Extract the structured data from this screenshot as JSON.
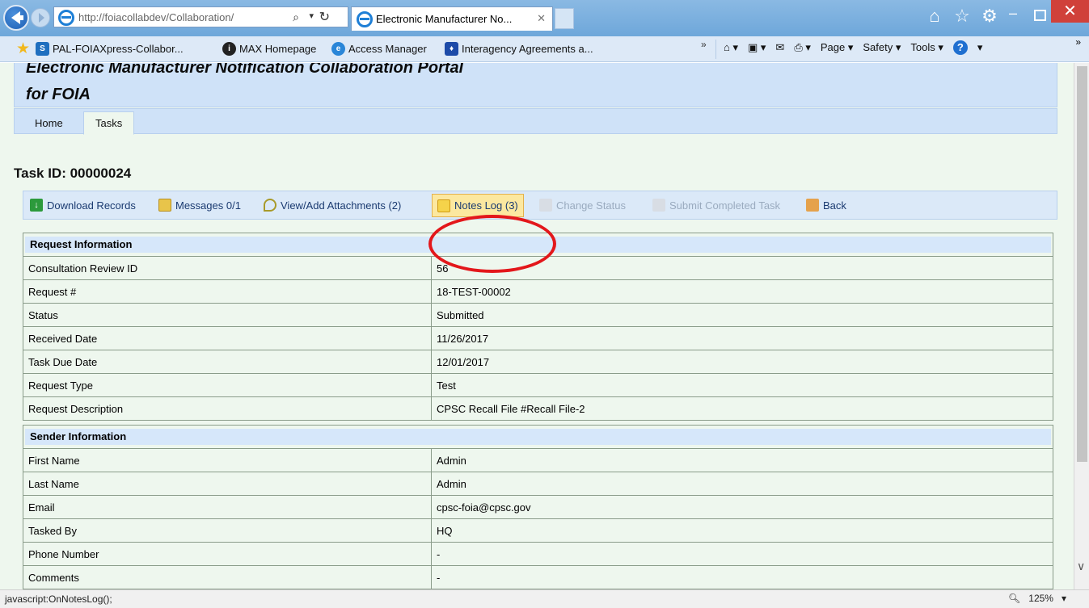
{
  "browser": {
    "address_url": "http://foiacollabdev/Collaboration/",
    "tab_title": "Electronic Manufacturer No...",
    "favorites": [
      "PAL-FOIAXpress-Collabor...",
      "MAX Homepage",
      "Access Manager",
      "Interagency Agreements a..."
    ],
    "commands": {
      "page": "Page",
      "safety": "Safety",
      "tools": "Tools"
    },
    "status_text": "javascript:OnNotesLog();",
    "zoom": "125%"
  },
  "site": {
    "title_line1": "Electronic Manufacturer Notification Collaboration Portal",
    "title_line2": "for FOIA",
    "nav": [
      "Home",
      "Tasks"
    ]
  },
  "task": {
    "heading": "Task ID: 00000024",
    "toolbar": {
      "download": "Download Records",
      "messages": "Messages 0/1",
      "attachments": "View/Add Attachments (2)",
      "notes": "Notes Log (3)",
      "change_status": "Change Status",
      "submit": "Submit Completed Task",
      "back": "Back"
    }
  },
  "request_info": {
    "heading": "Request Information",
    "rows": [
      {
        "label": "Consultation Review ID",
        "value": "56"
      },
      {
        "label": "Request #",
        "value": "18-TEST-00002"
      },
      {
        "label": "Status",
        "value": "Submitted"
      },
      {
        "label": "Received Date",
        "value": "11/26/2017"
      },
      {
        "label": "Task Due Date",
        "value": "12/01/2017"
      },
      {
        "label": "Request Type",
        "value": "Test"
      },
      {
        "label": "Request Description",
        "value": "CPSC Recall File #Recall File-2"
      }
    ]
  },
  "sender_info": {
    "heading": "Sender Information",
    "rows": [
      {
        "label": "First Name",
        "value": "Admin"
      },
      {
        "label": "Last Name",
        "value": "Admin"
      },
      {
        "label": "Email",
        "value": "cpsc-foia@cpsc.gov"
      },
      {
        "label": "Tasked By",
        "value": "HQ"
      },
      {
        "label": "Phone Number",
        "value": "-"
      },
      {
        "label": "Comments",
        "value": "-"
      }
    ]
  },
  "colors": {
    "page_bg": "#eef7ee",
    "header_bg": "#cfe2f8",
    "highlight": "#fce8a0",
    "annotation": "#e3171b"
  }
}
